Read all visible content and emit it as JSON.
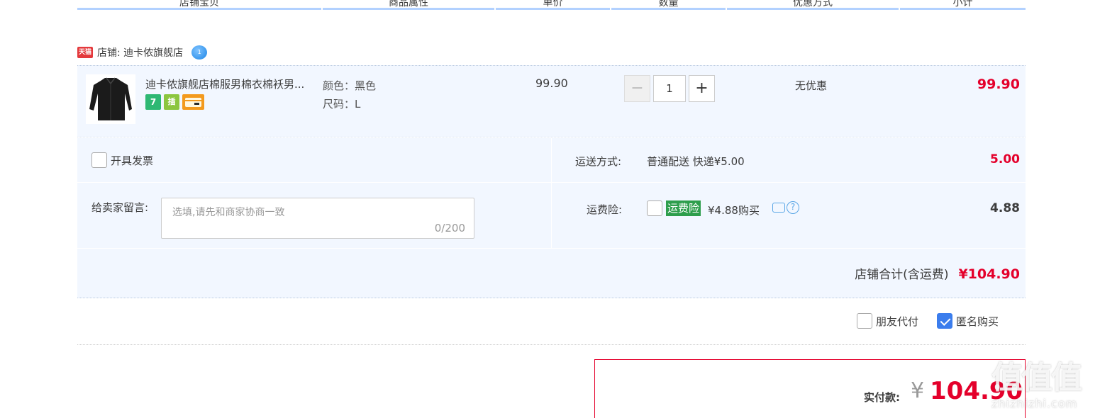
{
  "columns": [
    "店铺宝贝",
    "商品属性",
    "单价",
    "数量",
    "优惠方式",
    "小计"
  ],
  "shop": {
    "tmall_badge": "天猫",
    "label": "店铺: 迪卡侬旗舰店",
    "wangwang_badge": "1"
  },
  "item": {
    "title": "迪卡侬旗舰店棉服男棉衣棉袄男...",
    "badges": [
      "7",
      "插",
      "卡"
    ],
    "color_attr": "颜色：黑色",
    "size_attr": "尺码：L",
    "unit_price": "99.90",
    "quantity": "1",
    "minus": "−",
    "plus": "+",
    "promo": "无优惠",
    "subtotal": "99.90"
  },
  "options": {
    "invoice_label": "开具发票",
    "shipping_label": "运送方式:",
    "shipping_value": "普通配送 快递¥5.00",
    "shipping_fee": "5.00",
    "message_label": "给卖家留言:",
    "message_placeholder": "选填,请先和商家协商一致",
    "message_count": "0/200",
    "insurance_label": "运费险:",
    "insurance_tag": "运费险",
    "insurance_price": "¥4.88购买",
    "insurance_fee": "4.88",
    "help_glyph": "?",
    "shop_total_label": "店铺合计(含运费)",
    "shop_total_value": "¥104.90"
  },
  "extras": {
    "friend_pay": "朋友代付",
    "anonymous": "匿名购买",
    "anonymous_checked": true
  },
  "payment": {
    "label": "实付款:",
    "currency": "¥",
    "value": "104.90"
  },
  "watermark": {
    "big": "值值值",
    "small": "zhizhizhi.com"
  },
  "colors": {
    "accent_red": "#e4002b",
    "header_blue": "#b2d1ff",
    "row_bg": "#f2f7ff",
    "check_blue": "#3b7ded",
    "insurance_green": "#2e9e4c"
  }
}
